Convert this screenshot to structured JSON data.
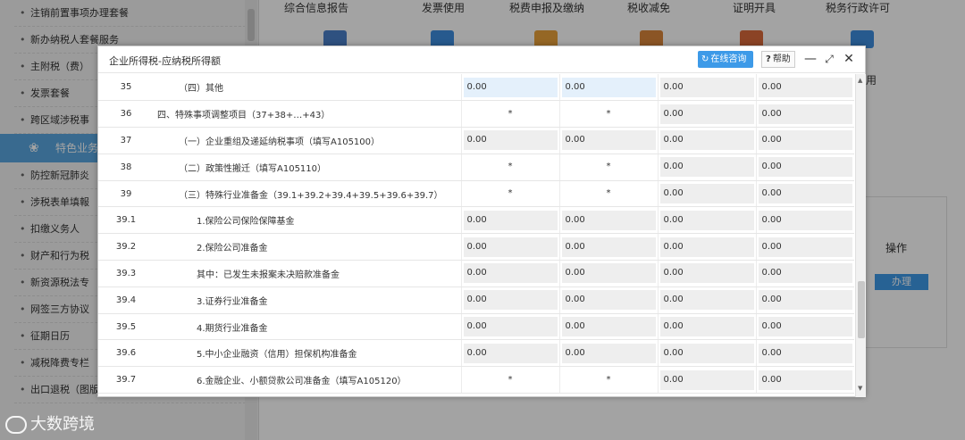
{
  "sidebar": {
    "items": [
      {
        "label": "注销前置事项办理套餐"
      },
      {
        "label": "新办纳税人套餐服务"
      },
      {
        "label": "主附税（费）"
      },
      {
        "label": "发票套餐"
      },
      {
        "label": "跨区域涉税事"
      },
      {
        "label": "特色业务",
        "active": true,
        "icon": "flower-icon"
      },
      {
        "label": "防控新冠肺炎"
      },
      {
        "label": "涉税表单填報"
      },
      {
        "label": "扣缴义务人"
      },
      {
        "label": "财产和行为税"
      },
      {
        "label": "新资源税法专"
      },
      {
        "label": "网签三方协议"
      },
      {
        "label": "征期日历"
      },
      {
        "label": "减税降费专栏"
      },
      {
        "label": "出口退税（图版）"
      }
    ]
  },
  "topnav": {
    "items": [
      {
        "label": "综合信息报告"
      },
      {
        "label": "发票使用"
      },
      {
        "label": "税费申报及缴纳"
      },
      {
        "label": "税收减免"
      },
      {
        "label": "证明开具"
      },
      {
        "label": "税务行政许可"
      }
    ]
  },
  "panel": {
    "op_label": "操作",
    "action_label": "办理",
    "partial_text": "用"
  },
  "modal": {
    "title": "企业所得税-应纳税所得额",
    "consult_label": "在线咨询",
    "help_label": "帮助"
  },
  "rows": [
    {
      "num": "35",
      "name": "（四）其他",
      "indent": 1,
      "v": [
        "0.00",
        "0.00",
        "0.00",
        "0.00"
      ],
      "t": [
        "edit",
        "edit",
        "ro",
        "ro"
      ]
    },
    {
      "num": "36",
      "name": "四、特殊事项调整项目（37+38+…+43）",
      "indent": 0,
      "v": [
        "*",
        "*",
        "0.00",
        "0.00"
      ],
      "t": [
        "star",
        "star",
        "ro",
        "ro"
      ]
    },
    {
      "num": "37",
      "name": "（一）企业重组及递延纳税事项（填写A105100）",
      "indent": 1,
      "v": [
        "0.00",
        "0.00",
        "0.00",
        "0.00"
      ],
      "t": [
        "ro",
        "ro",
        "ro",
        "ro"
      ]
    },
    {
      "num": "38",
      "name": "（二）政策性搬迁（填写A105110）",
      "indent": 1,
      "v": [
        "*",
        "*",
        "0.00",
        "0.00"
      ],
      "t": [
        "star",
        "star",
        "ro",
        "ro"
      ]
    },
    {
      "num": "39",
      "name": "（三）特殊行业准备金（39.1+39.2+39.4+39.5+39.6+39.7）",
      "indent": 1,
      "v": [
        "*",
        "*",
        "0.00",
        "0.00"
      ],
      "t": [
        "star",
        "star",
        "ro",
        "ro"
      ]
    },
    {
      "num": "39.1",
      "name": "1.保险公司保险保障基金",
      "indent": 2,
      "v": [
        "0.00",
        "0.00",
        "0.00",
        "0.00"
      ],
      "t": [
        "ro",
        "ro",
        "ro",
        "ro"
      ]
    },
    {
      "num": "39.2",
      "name": "2.保险公司准备金",
      "indent": 2,
      "v": [
        "0.00",
        "0.00",
        "0.00",
        "0.00"
      ],
      "t": [
        "ro",
        "ro",
        "ro",
        "ro"
      ]
    },
    {
      "num": "39.3",
      "name": "其中：已发生未报案未决赔款准备金",
      "indent": 2,
      "v": [
        "0.00",
        "0.00",
        "0.00",
        "0.00"
      ],
      "t": [
        "ro",
        "ro",
        "ro",
        "ro"
      ]
    },
    {
      "num": "39.4",
      "name": "3.证券行业准备金",
      "indent": 2,
      "v": [
        "0.00",
        "0.00",
        "0.00",
        "0.00"
      ],
      "t": [
        "ro",
        "ro",
        "ro",
        "ro"
      ]
    },
    {
      "num": "39.5",
      "name": "4.期货行业准备金",
      "indent": 2,
      "v": [
        "0.00",
        "0.00",
        "0.00",
        "0.00"
      ],
      "t": [
        "ro",
        "ro",
        "ro",
        "ro"
      ]
    },
    {
      "num": "39.6",
      "name": "5.中小企业融资（信用）担保机构准备金",
      "indent": 2,
      "v": [
        "0.00",
        "0.00",
        "0.00",
        "0.00"
      ],
      "t": [
        "ro",
        "ro",
        "ro",
        "ro"
      ]
    },
    {
      "num": "39.7",
      "name": "6.金融企业、小额贷款公司准备金（填写A105120）",
      "indent": 2,
      "v": [
        "*",
        "*",
        "0.00",
        "0.00"
      ],
      "t": [
        "star",
        "star",
        "ro",
        "ro"
      ]
    }
  ],
  "watermark": {
    "text": "大数跨境"
  }
}
